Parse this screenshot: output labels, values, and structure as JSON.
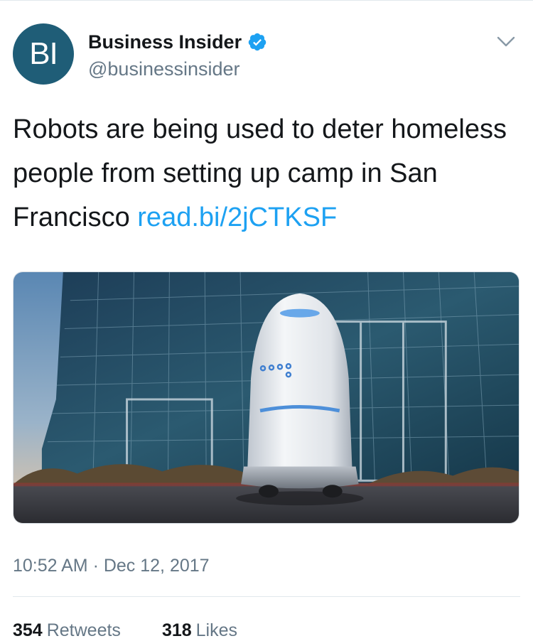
{
  "author": {
    "avatar_text": "BI",
    "name": "Business Insider",
    "handle": "@businessinsider",
    "verified": true
  },
  "tweet": {
    "text": "Robots are being used to deter homeless people from setting up camp in San Francisco",
    "link": "read.bi/2jCTKSF"
  },
  "media": {
    "description": "photo-security-robot-in-front-of-glass-building"
  },
  "timestamp": "10:52 AM · Dec 12, 2017",
  "stats": {
    "retweets_count": "354",
    "retweets_label": "Retweets",
    "likes_count": "318",
    "likes_label": "Likes"
  },
  "icons": {
    "verified": "verified-badge-icon",
    "menu": "chevron-down-icon"
  },
  "colors": {
    "link": "#1da1f2",
    "muted": "#657786",
    "avatar_bg": "#1f5d77",
    "verified": "#1da1f2"
  }
}
